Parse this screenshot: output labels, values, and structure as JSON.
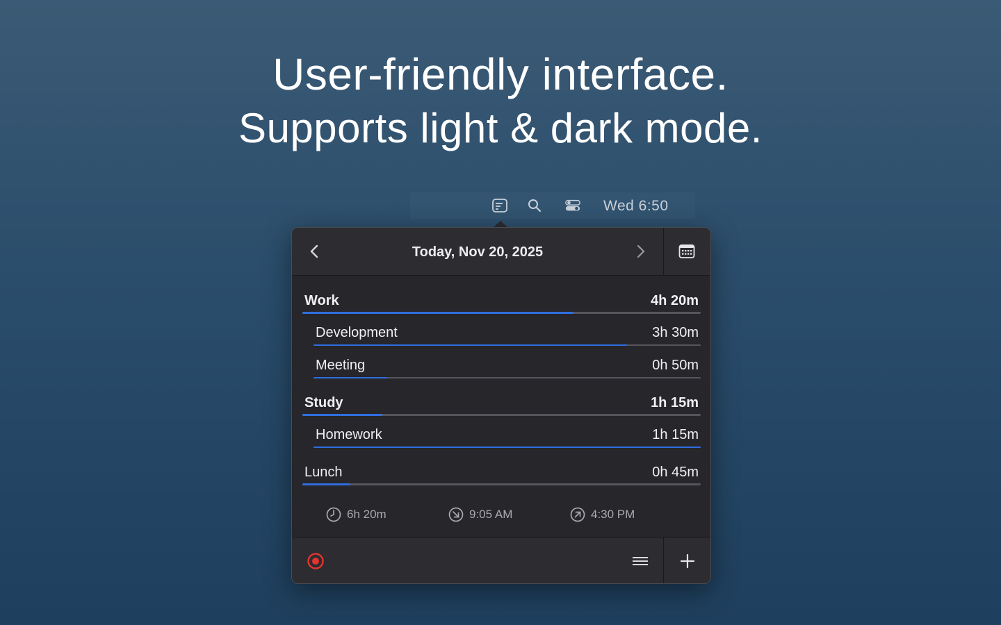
{
  "headline": {
    "line1": "User-friendly interface.",
    "line2": "Supports light & dark mode."
  },
  "menubar": {
    "icons": [
      "app-menu-icon",
      "search-icon",
      "control-center-icon"
    ],
    "clock": "Wed 6:50"
  },
  "popover": {
    "date_title": "Today, Nov 20, 2025",
    "entries": [
      {
        "kind": "category",
        "label": "Work",
        "duration": "4h 20m",
        "progress": 0.68
      },
      {
        "kind": "subcategory",
        "label": "Development",
        "duration": "3h 30m",
        "progress": 0.81
      },
      {
        "kind": "subcategory",
        "label": "Meeting",
        "duration": "0h 50m",
        "progress": 0.19
      },
      {
        "kind": "category",
        "label": "Study",
        "duration": "1h 15m",
        "progress": 0.2
      },
      {
        "kind": "subcategory",
        "label": "Homework",
        "duration": "1h 15m",
        "progress": 1.0
      },
      {
        "kind": "category",
        "label": "Lunch",
        "duration": "0h 45m",
        "progress": 0.12
      }
    ],
    "stats": {
      "total": "6h 20m",
      "start": "9:05 AM",
      "end": "4:30 PM"
    },
    "colors": {
      "accent": "#2f6ee0",
      "record": "#e5342f"
    }
  }
}
